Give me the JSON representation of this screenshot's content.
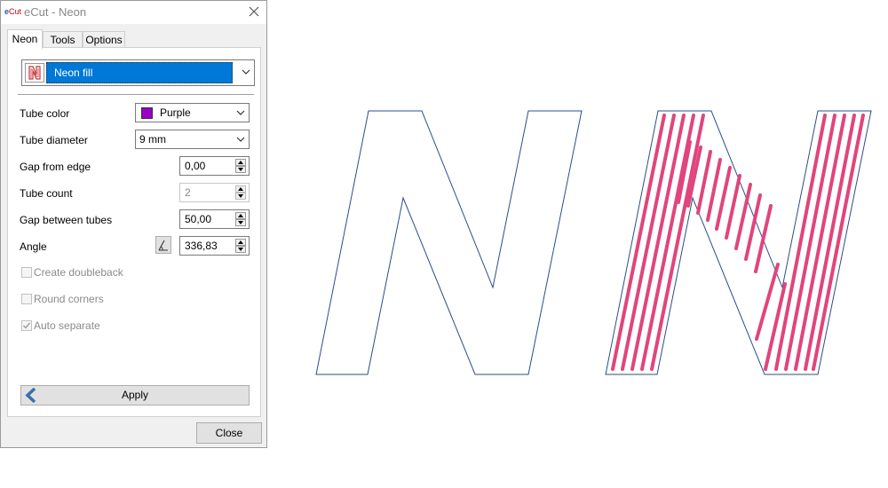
{
  "window": {
    "logo": {
      "e": "e",
      "cut": "Cut"
    },
    "title": "eCut - Neon"
  },
  "tabs": [
    {
      "label": "Neon",
      "active": true
    },
    {
      "label": "Tools",
      "active": false
    },
    {
      "label": "Options",
      "active": false
    }
  ],
  "mode": {
    "icon": "neon-n-icon",
    "selected": "Neon fill"
  },
  "fields": {
    "tube_color": {
      "label": "Tube color",
      "value": "Purple",
      "swatch": "#9b00c8"
    },
    "tube_diameter": {
      "label": "Tube diameter",
      "value": "9 mm"
    },
    "gap_from_edge": {
      "label": "Gap from edge",
      "value": "0,00"
    },
    "tube_count": {
      "label": "Tube count",
      "value": "2",
      "disabled": true
    },
    "gap_between_tubes": {
      "label": "Gap between tubes",
      "value": "50,00"
    },
    "angle": {
      "label": "Angle",
      "value": "336,83"
    }
  },
  "checkboxes": [
    {
      "label": "Create doubleback",
      "checked": false,
      "disabled": true
    },
    {
      "label": "Round corners",
      "checked": false,
      "disabled": true
    },
    {
      "label": "Auto separate",
      "checked": true,
      "disabled": true
    }
  ],
  "buttons": {
    "apply": "Apply",
    "close": "Close"
  },
  "colors": {
    "outline": "#2b4c8c",
    "neon_tube": "#e0457b",
    "selection": "#0078d7"
  }
}
